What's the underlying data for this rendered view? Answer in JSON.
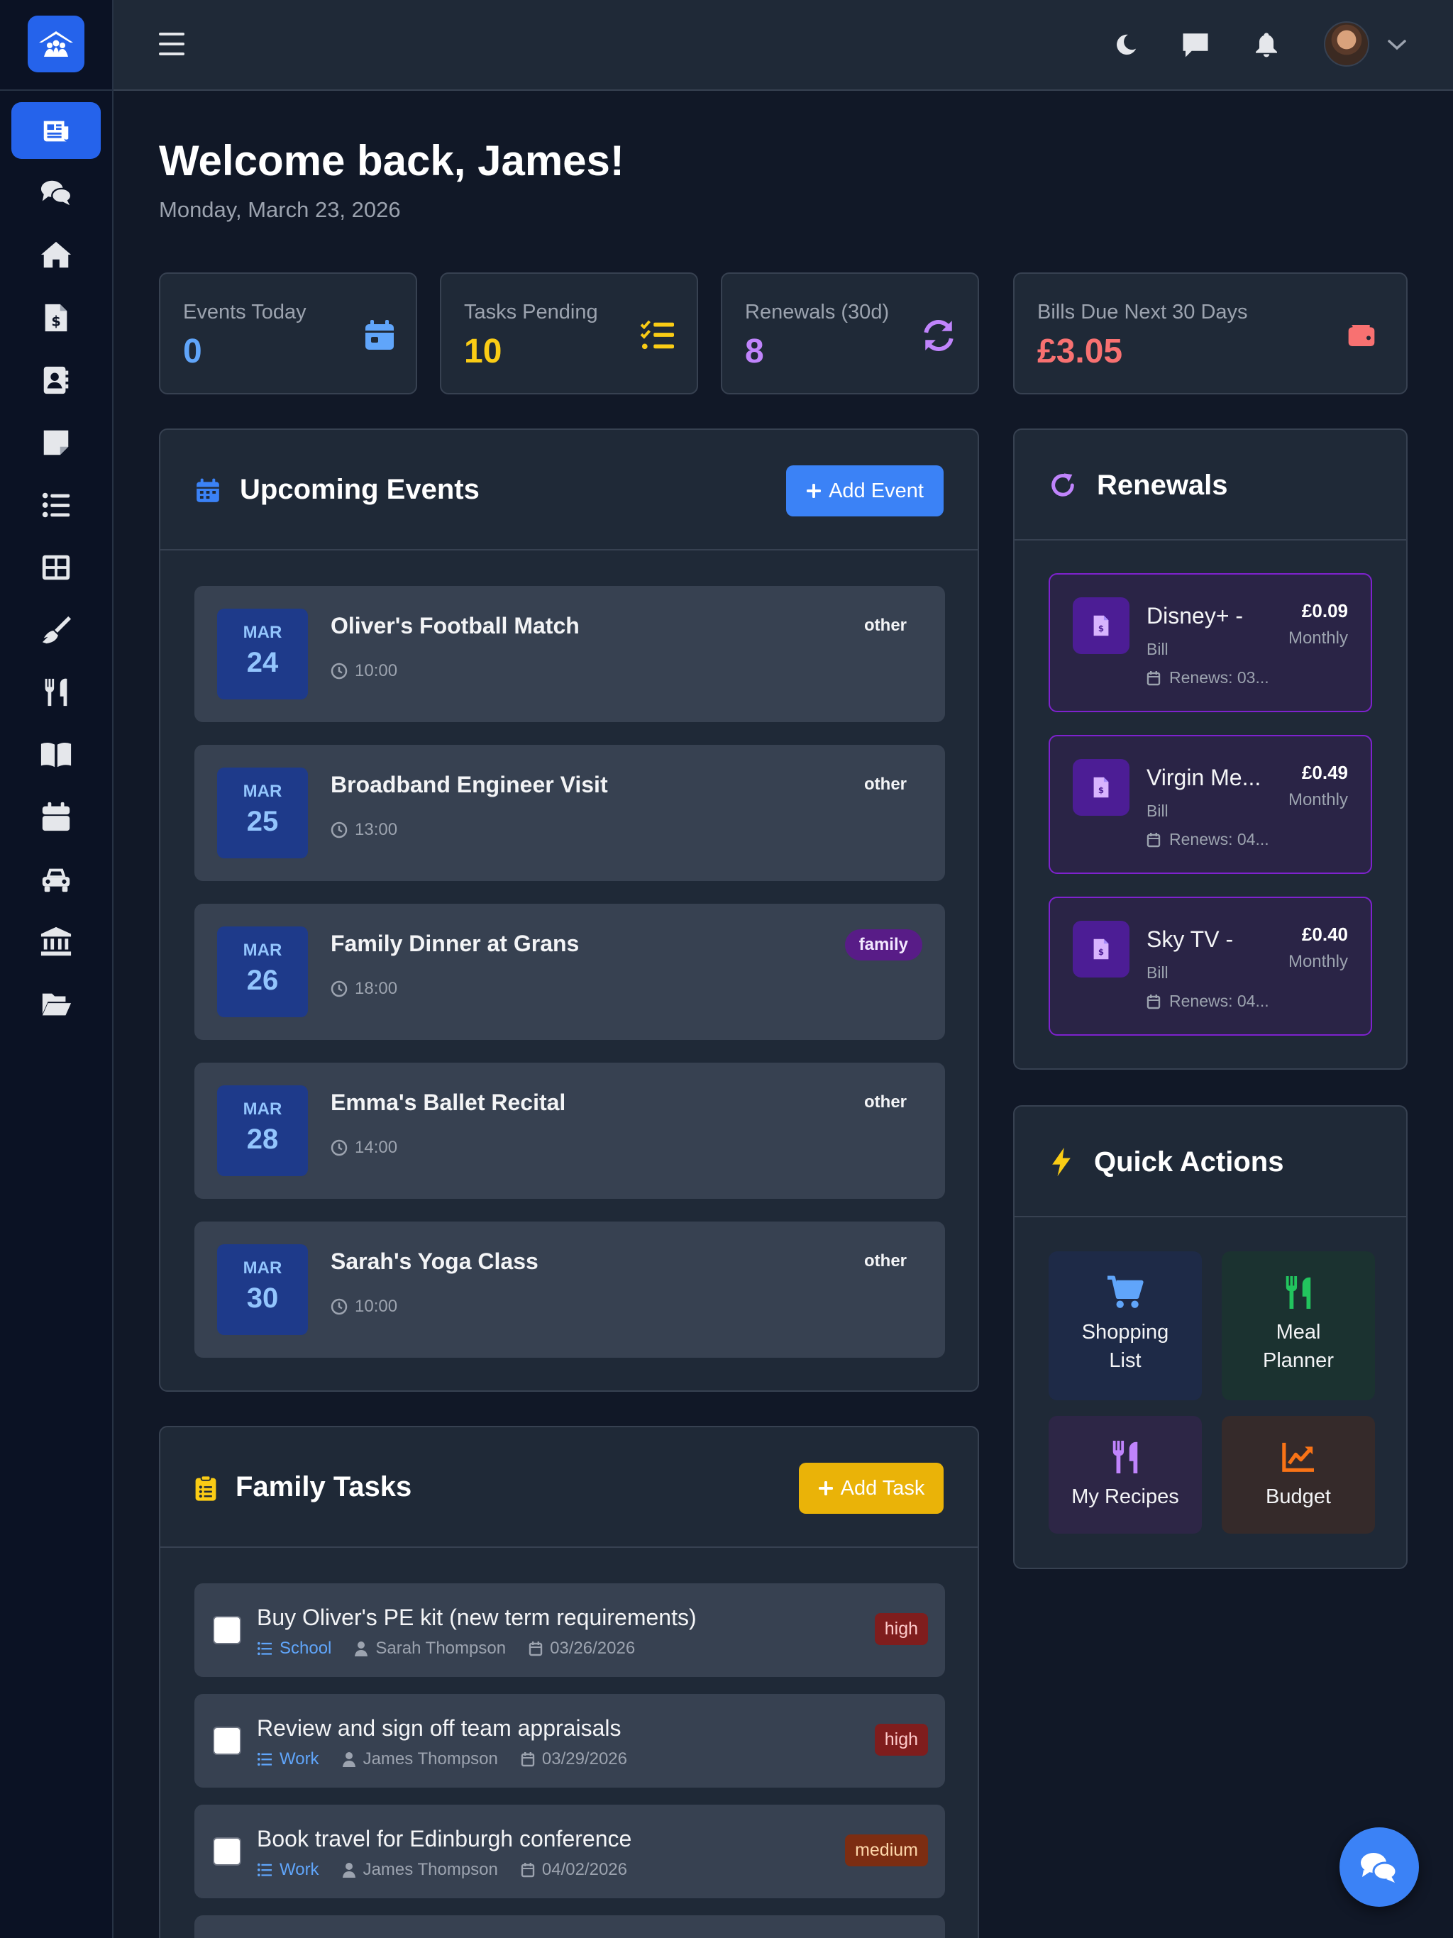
{
  "sidebar": {
    "items": [
      {
        "icon": "newspaper-icon",
        "active": true
      },
      {
        "icon": "comments-icon"
      },
      {
        "icon": "home-icon"
      },
      {
        "icon": "invoice-icon"
      },
      {
        "icon": "address-book-icon"
      },
      {
        "icon": "sticky-note-icon"
      },
      {
        "icon": "list-icon"
      },
      {
        "icon": "grid-icon"
      },
      {
        "icon": "broom-icon"
      },
      {
        "icon": "utensils-icon"
      },
      {
        "icon": "book-icon"
      },
      {
        "icon": "calendar-icon"
      },
      {
        "icon": "car-icon"
      },
      {
        "icon": "bank-icon"
      },
      {
        "icon": "folder-open-icon"
      }
    ]
  },
  "header": {
    "welcome": "Welcome back, James!",
    "date": "Monday, March 23, 2026"
  },
  "stats": {
    "events_today": {
      "label": "Events Today",
      "value": "0",
      "color": "#60a5fa"
    },
    "tasks_pending": {
      "label": "Tasks Pending",
      "value": "10",
      "color": "#facc15"
    },
    "renewals": {
      "label": "Renewals (30d)",
      "value": "8",
      "color": "#c084fc"
    },
    "bills_due": {
      "label": "Bills Due Next 30 Days",
      "value": "£3.05",
      "color": "#f87171"
    }
  },
  "events": {
    "title": "Upcoming Events",
    "add_label": "Add Event",
    "items": [
      {
        "month": "MAR",
        "day": "24",
        "title": "Oliver's Football Match",
        "time": "10:00",
        "category": "other"
      },
      {
        "month": "MAR",
        "day": "25",
        "title": "Broadband Engineer Visit",
        "time": "13:00",
        "category": "other"
      },
      {
        "month": "MAR",
        "day": "26",
        "title": "Family Dinner at Grans",
        "time": "18:00",
        "category": "family"
      },
      {
        "month": "MAR",
        "day": "28",
        "title": "Emma's Ballet Recital",
        "time": "14:00",
        "category": "other"
      },
      {
        "month": "MAR",
        "day": "30",
        "title": "Sarah's Yoga Class",
        "time": "10:00",
        "category": "other"
      }
    ]
  },
  "tasks": {
    "title": "Family Tasks",
    "add_label": "Add Task",
    "items": [
      {
        "title": "Buy Oliver's PE kit (new term requirements)",
        "category": "School",
        "assignee": "Sarah Thompson",
        "due": "03/26/2026",
        "priority": "high"
      },
      {
        "title": "Review and sign off team appraisals",
        "category": "Work",
        "assignee": "James Thompson",
        "due": "03/29/2026",
        "priority": "high"
      },
      {
        "title": "Book travel for Edinburgh conference",
        "category": "Work",
        "assignee": "James Thompson",
        "due": "04/02/2026",
        "priority": "medium"
      }
    ]
  },
  "renewals": {
    "title": "Renewals",
    "items": [
      {
        "name": "Disney+ -",
        "type": "Bill",
        "renews": "Renews: 03...",
        "amount": "£0.09",
        "period": "Monthly"
      },
      {
        "name": "Virgin Me...",
        "type": "Bill",
        "renews": "Renews: 04...",
        "amount": "£0.49",
        "period": "Monthly"
      },
      {
        "name": "Sky TV -",
        "type": "Bill",
        "renews": "Renews: 04...",
        "amount": "£0.40",
        "period": "Monthly"
      }
    ]
  },
  "quick_actions": {
    "title": "Quick Actions",
    "items": [
      {
        "label": "Shopping List",
        "line1": "Shopping",
        "line2": "List",
        "icon": "cart-icon",
        "color": "#60a5fa"
      },
      {
        "label": "Meal Planner",
        "line1": "Meal",
        "line2": "Planner",
        "icon": "utensils-icon",
        "color": "#22c55e"
      },
      {
        "label": "My Recipes",
        "icon": "utensils-icon",
        "color": "#c084fc"
      },
      {
        "label": "Budget",
        "icon": "chart-line-icon",
        "color": "#f97316"
      }
    ]
  }
}
